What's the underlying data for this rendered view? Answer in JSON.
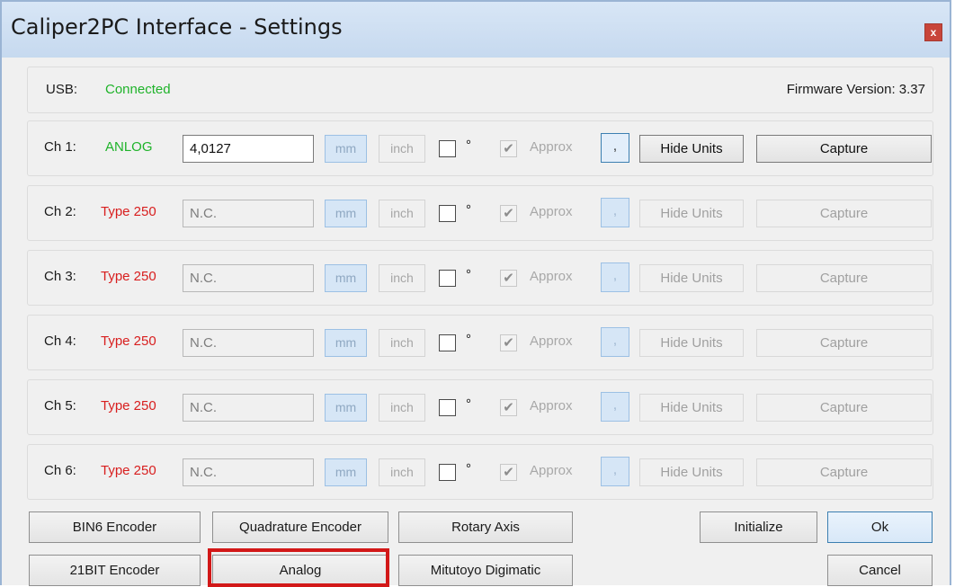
{
  "window": {
    "title": "Caliper2PC Interface - Settings",
    "close_label": "x"
  },
  "status": {
    "usb_label": "USB:",
    "usb_value": "Connected",
    "firmware_label": "Firmware Version: 3.37"
  },
  "colors": {
    "connected": "#1fb32a",
    "type_warning": "#d81e1e",
    "highlight": "#d21818"
  },
  "channels": [
    {
      "label": "Ch 1:",
      "type": "ANLOG",
      "value": "4,0127",
      "mm": "mm",
      "inch": "inch",
      "degree": "°",
      "approx": "Approx",
      "approx_checked": true,
      "decimal": ",",
      "hide_units": "Hide Units",
      "capture": "Capture"
    },
    {
      "label": "Ch 2:",
      "type": "Type 250",
      "value": "N.C.",
      "mm": "mm",
      "inch": "inch",
      "degree": "°",
      "approx": "Approx",
      "approx_checked": true,
      "decimal": ",",
      "hide_units": "Hide Units",
      "capture": "Capture"
    },
    {
      "label": "Ch 3:",
      "type": "Type 250",
      "value": "N.C.",
      "mm": "mm",
      "inch": "inch",
      "degree": "°",
      "approx": "Approx",
      "approx_checked": true,
      "decimal": ",",
      "hide_units": "Hide Units",
      "capture": "Capture"
    },
    {
      "label": "Ch 4:",
      "type": "Type 250",
      "value": "N.C.",
      "mm": "mm",
      "inch": "inch",
      "degree": "°",
      "approx": "Approx",
      "approx_checked": true,
      "decimal": ",",
      "hide_units": "Hide Units",
      "capture": "Capture"
    },
    {
      "label": "Ch 5:",
      "type": "Type 250",
      "value": "N.C.",
      "mm": "mm",
      "inch": "inch",
      "degree": "°",
      "approx": "Approx",
      "approx_checked": true,
      "decimal": ",",
      "hide_units": "Hide Units",
      "capture": "Capture"
    },
    {
      "label": "Ch 6:",
      "type": "Type 250",
      "value": "N.C.",
      "mm": "mm",
      "inch": "inch",
      "degree": "°",
      "approx": "Approx",
      "approx_checked": true,
      "decimal": ",",
      "hide_units": "Hide Units",
      "capture": "Capture"
    }
  ],
  "buttons": {
    "bin6": "BIN6 Encoder",
    "quadrature": "Quadrature Encoder",
    "rotary": "Rotary Axis",
    "initialize": "Initialize",
    "ok": "Ok",
    "bit21": "21BIT Encoder",
    "analog": "Analog",
    "mitutoyo": "Mitutoyo Digimatic",
    "cancel": "Cancel"
  }
}
